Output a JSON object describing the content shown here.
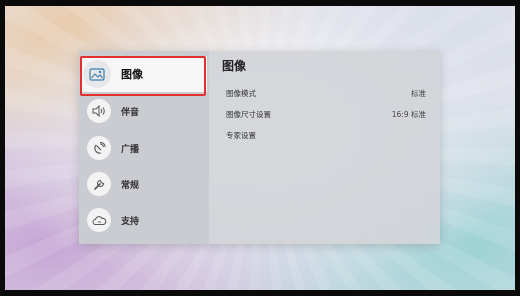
{
  "sidebar": {
    "items": [
      {
        "label": "图像",
        "icon": "picture-icon",
        "active": true
      },
      {
        "label": "伴音",
        "icon": "speaker-icon",
        "active": false
      },
      {
        "label": "广播",
        "icon": "antenna-icon",
        "active": false
      },
      {
        "label": "常规",
        "icon": "wrench-icon",
        "active": false
      },
      {
        "label": "支持",
        "icon": "cloud-icon",
        "active": false
      }
    ]
  },
  "content": {
    "title": "图像",
    "rows": [
      {
        "label": "图像模式",
        "value": "标准"
      },
      {
        "label": "图像尺寸设置",
        "value": "16:9 标准"
      },
      {
        "label": "专家设置",
        "value": ""
      }
    ]
  },
  "colors": {
    "highlight": "#e03030",
    "panel": "#d2d4d8"
  }
}
